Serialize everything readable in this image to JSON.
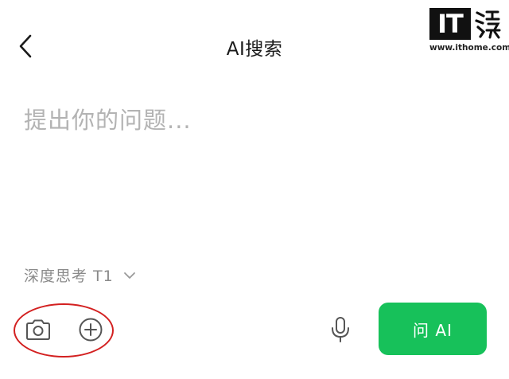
{
  "header": {
    "title": "AI搜索",
    "back_icon": "chevron-left-icon"
  },
  "watermark": {
    "logo_text": "IT",
    "url": "www.ithome.com"
  },
  "prompt": {
    "placeholder": "提出你的问题...",
    "value": ""
  },
  "model": {
    "label": "深度思考 T1",
    "icon": "chevron-down-icon"
  },
  "toolbar": {
    "camera_icon": "camera-icon",
    "plus_icon": "plus-circle-icon",
    "mic_icon": "microphone-icon",
    "ask_label": "问 AI"
  },
  "colors": {
    "accent": "#17c15a",
    "annotation": "#d32020",
    "placeholder": "#b3b3b3",
    "secondary_text": "#8a8a8a"
  }
}
